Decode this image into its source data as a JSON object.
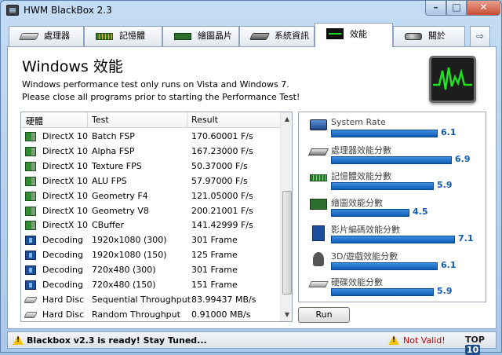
{
  "window": {
    "title": "HWM BlackBox 2.3"
  },
  "tabs": [
    {
      "label": "處理器",
      "icon": "cpu-icon"
    },
    {
      "label": "記憶體",
      "icon": "memory-icon"
    },
    {
      "label": "繪圖晶片",
      "icon": "graphics-card-icon"
    },
    {
      "label": "系統資訊",
      "icon": "system-info-icon"
    },
    {
      "label": "效能",
      "icon": "performance-monitor-icon",
      "active": true
    },
    {
      "label": "關於",
      "icon": "about-icon"
    }
  ],
  "header": {
    "title": "Windows 效能",
    "desc_line1": "Windows performance test only runs on Vista and Windows 7.",
    "desc_line2": "Please close all programs prior to starting the Performance Test!"
  },
  "table": {
    "headers": [
      "硬體",
      "Test",
      "Result"
    ],
    "rows": [
      {
        "hardware": "DirectX 10",
        "test": "Batch FSP",
        "result": "170.60001 F/s",
        "icon": "directx-icon"
      },
      {
        "hardware": "DirectX 10",
        "test": "Alpha FSP",
        "result": "167.23000 F/s",
        "icon": "directx-icon"
      },
      {
        "hardware": "DirectX 10",
        "test": "Texture FPS",
        "result": "50.37000 F/s",
        "icon": "directx-icon"
      },
      {
        "hardware": "DirectX 10",
        "test": "ALU FPS",
        "result": "57.97000 F/s",
        "icon": "directx-icon"
      },
      {
        "hardware": "DirectX 10",
        "test": "Geometry F4",
        "result": "121.05000 F/s",
        "icon": "directx-icon"
      },
      {
        "hardware": "DirectX 10",
        "test": "Geometry V8",
        "result": "200.21001 F/s",
        "icon": "directx-icon"
      },
      {
        "hardware": "DirectX 10",
        "test": "CBuffer",
        "result": "141.42999 F/s",
        "icon": "directx-icon"
      },
      {
        "hardware": "Decoding",
        "test": "1920x1080 (300)",
        "result": "301 Frame",
        "icon": "video-decode-icon"
      },
      {
        "hardware": "Decoding",
        "test": "1920x1080 (150)",
        "result": "125 Frame",
        "icon": "video-decode-icon"
      },
      {
        "hardware": "Decoding",
        "test": "720x480 (300)",
        "result": "301 Frame",
        "icon": "video-decode-icon"
      },
      {
        "hardware": "Decoding",
        "test": "720x480 (150)",
        "result": "151 Frame",
        "icon": "video-decode-icon"
      },
      {
        "hardware": "Hard Disc",
        "test": "Sequential Throughput",
        "result": "83.99437 MB/s",
        "icon": "hard-disk-icon"
      },
      {
        "hardware": "Hard Disc",
        "test": "Random Throughput",
        "result": "0.91000 MB/s",
        "icon": "hard-disk-icon"
      }
    ]
  },
  "scores": {
    "max": 7.9,
    "items": [
      {
        "label": "System Rate",
        "value": "6.1",
        "icon": "system-rate-icon"
      },
      {
        "label": "處理器效能分數",
        "value": "6.9",
        "icon": "processor-icon"
      },
      {
        "label": "記憶體效能分數",
        "value": "5.9",
        "icon": "memory-icon"
      },
      {
        "label": "繪圖效能分數",
        "value": "4.5",
        "icon": "graphics-icon"
      },
      {
        "label": "影片編碼效能分數",
        "value": "7.1",
        "icon": "video-encode-icon"
      },
      {
        "label": "3D/遊戲效能分數",
        "value": "6.1",
        "icon": "gaming-icon"
      },
      {
        "label": "硬碟效能分數",
        "value": "5.9",
        "icon": "hard-disk-icon"
      }
    ]
  },
  "run_button": {
    "label": "Run"
  },
  "status": {
    "left": "Blackbox v2.3 is ready! Stay Tuned...",
    "right": "Not Valid!",
    "badge_text": "TOP",
    "badge_num": "10"
  },
  "colors": {
    "bar": "#1566c7",
    "score_text": "#0d5cb6",
    "warning": "#f2c200",
    "error": "#c00000"
  }
}
